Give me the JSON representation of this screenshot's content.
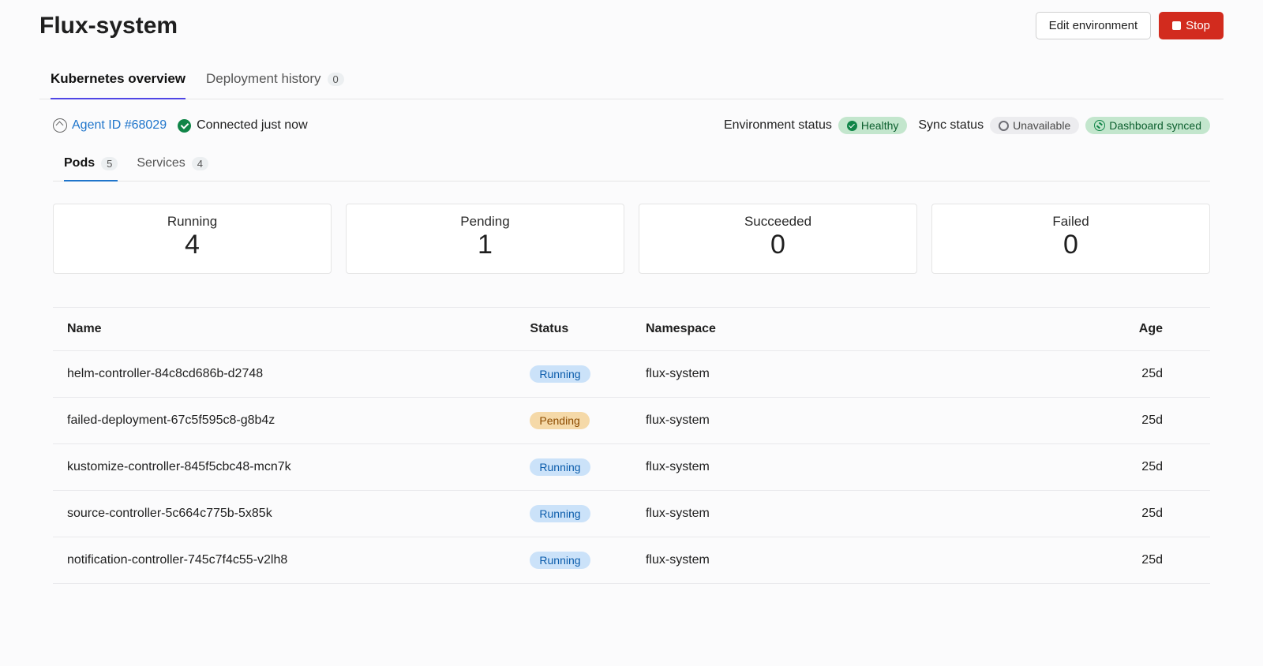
{
  "header": {
    "title": "Flux-system",
    "edit_label": "Edit environment",
    "stop_label": "Stop"
  },
  "main_tabs": [
    {
      "label": "Kubernetes overview",
      "count": null,
      "active": true
    },
    {
      "label": "Deployment history",
      "count": "0",
      "active": false
    }
  ],
  "agent": {
    "link_text": "Agent ID #68029",
    "connected_text": "Connected just now"
  },
  "status_chips": {
    "env_label": "Environment status",
    "env_value": "Healthy",
    "sync_label": "Sync status",
    "sync_value": "Unavailable",
    "dashboard_value": "Dashboard synced"
  },
  "sub_tabs": [
    {
      "label": "Pods",
      "count": "5",
      "active": true
    },
    {
      "label": "Services",
      "count": "4",
      "active": false
    }
  ],
  "stats": [
    {
      "label": "Running",
      "value": "4"
    },
    {
      "label": "Pending",
      "value": "1"
    },
    {
      "label": "Succeeded",
      "value": "0"
    },
    {
      "label": "Failed",
      "value": "0"
    }
  ],
  "table": {
    "columns": [
      "Name",
      "Status",
      "Namespace",
      "Age"
    ],
    "rows": [
      {
        "name": "helm-controller-84c8cd686b-d2748",
        "status": "Running",
        "namespace": "flux-system",
        "age": "25d"
      },
      {
        "name": "failed-deployment-67c5f595c8-g8b4z",
        "status": "Pending",
        "namespace": "flux-system",
        "age": "25d"
      },
      {
        "name": "kustomize-controller-845f5cbc48-mcn7k",
        "status": "Running",
        "namespace": "flux-system",
        "age": "25d"
      },
      {
        "name": "source-controller-5c664c775b-5x85k",
        "status": "Running",
        "namespace": "flux-system",
        "age": "25d"
      },
      {
        "name": "notification-controller-745c7f4c55-v2lh8",
        "status": "Running",
        "namespace": "flux-system",
        "age": "25d"
      }
    ]
  }
}
